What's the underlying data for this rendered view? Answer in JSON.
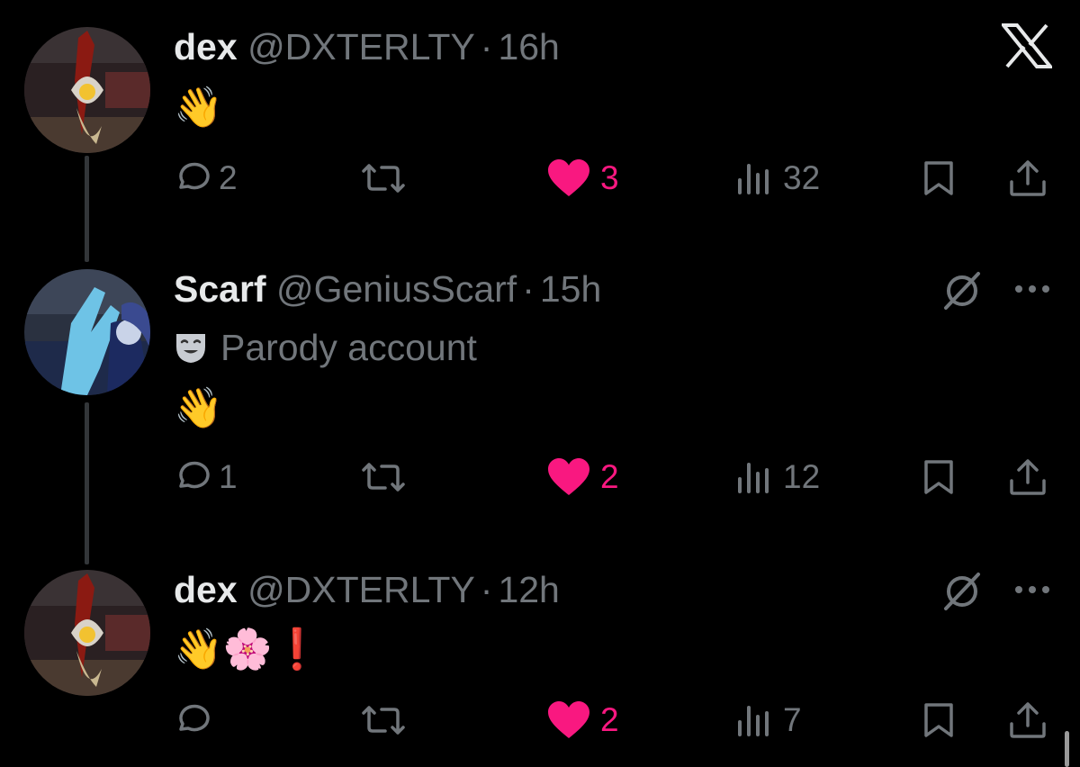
{
  "tweets": [
    {
      "name": "dex",
      "handle": "@DXTERLTY",
      "time": "16h",
      "body": "👋",
      "replies": "2",
      "likes": "3",
      "views": "32"
    },
    {
      "name": "Scarf",
      "handle": "@GeniusScarf",
      "time": "15h",
      "label": "Parody account",
      "body": "👋",
      "replies": "1",
      "likes": "2",
      "views": "12"
    },
    {
      "name": "dex",
      "handle": "@DXTERLTY",
      "time": "12h",
      "body": "👋🌸❗",
      "replies": "",
      "likes": "2",
      "views": "7"
    }
  ],
  "separator": "·",
  "colors": {
    "like": "#f91880",
    "muted": "#71767b",
    "text": "#e7e9ea",
    "background": "#000000"
  },
  "icons": [
    "x-logo-icon",
    "reply-icon",
    "retweet-icon",
    "heart-icon",
    "views-icon",
    "bookmark-icon",
    "share-icon",
    "grok-icon",
    "more-icon",
    "parody-mask-icon"
  ]
}
